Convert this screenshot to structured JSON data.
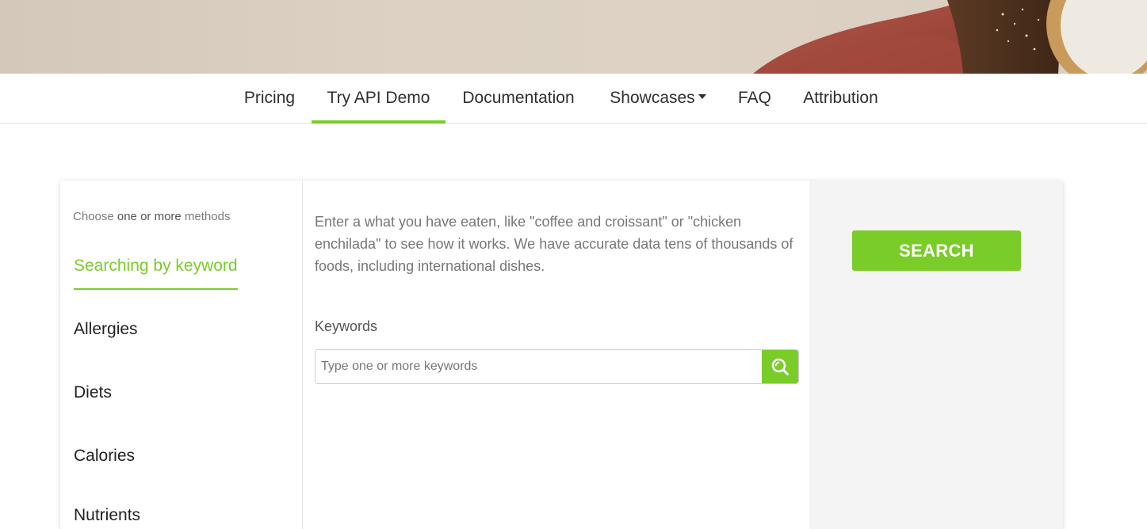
{
  "nav": {
    "items": [
      {
        "label": "Pricing"
      },
      {
        "label": "Try API Demo",
        "active": true
      },
      {
        "label": "Documentation"
      },
      {
        "label": "Showcases",
        "dropdown": true
      },
      {
        "label": "FAQ"
      },
      {
        "label": "Attribution"
      }
    ]
  },
  "left": {
    "hint_pre": "Choose ",
    "hint_bold": "one or more",
    "hint_post": " methods",
    "methods": [
      {
        "label": "Searching by keyword",
        "active": true
      },
      {
        "label": "Allergies"
      },
      {
        "label": "Diets"
      },
      {
        "label": "Calories"
      },
      {
        "label": "Nutrients"
      }
    ]
  },
  "middle": {
    "description": "Enter a what you have eaten, like \"coffee and croissant\" or \"chicken enchilada\" to see how it works. We have accurate data tens of thousands of foods, including international dishes.",
    "keywords_label": "Keywords",
    "keywords_placeholder": "Type one or more keywords",
    "keywords_value": "",
    "search_icon": "search-icon"
  },
  "right": {
    "search_label": "SEARCH"
  },
  "colors": {
    "accent": "#7acc29",
    "panel_bg": "#f4f4f4",
    "text": "#2f2f2f"
  }
}
